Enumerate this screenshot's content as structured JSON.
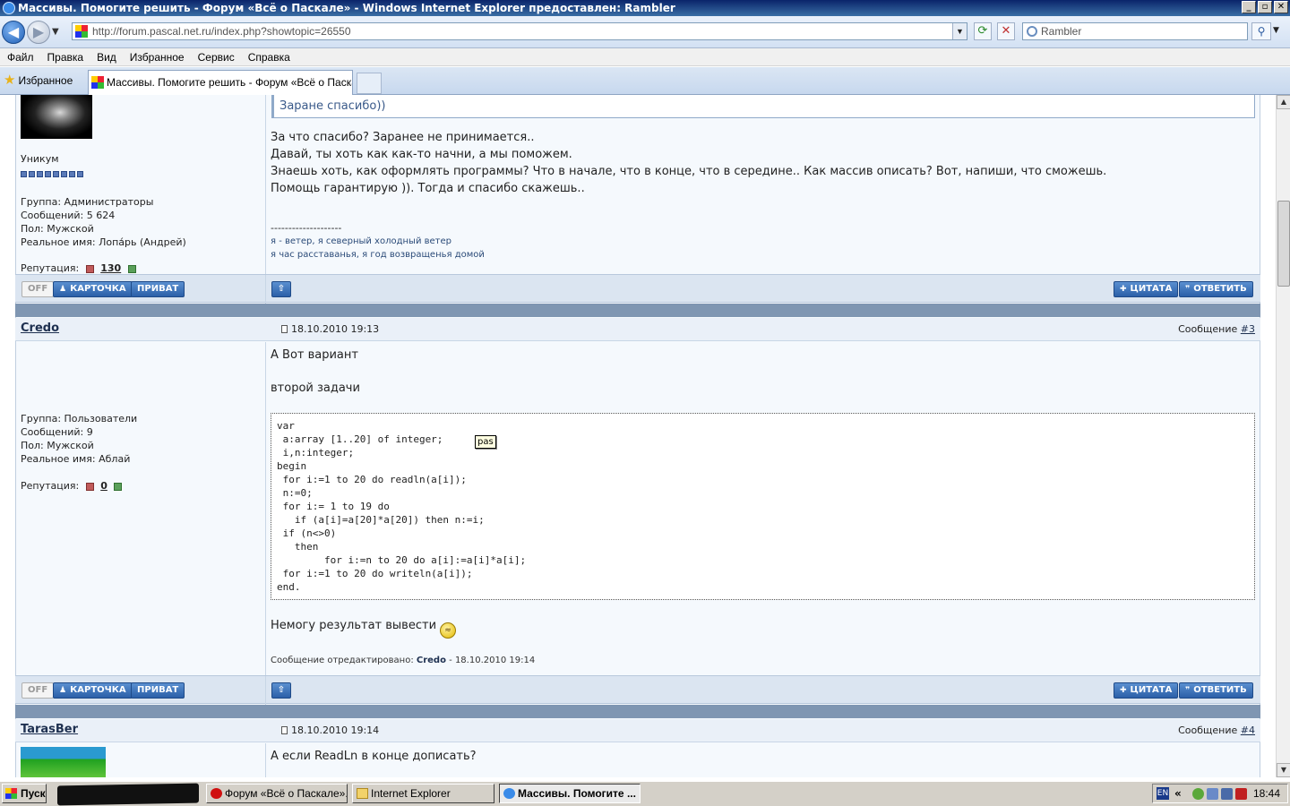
{
  "window": {
    "title": "Массивы. Помогите решить - Форум «Всё о Паскале» - Windows Internet Explorer предоставлен: Rambler",
    "controls": {
      "minimize": "_",
      "maximize": "▫",
      "close": "✕"
    }
  },
  "address": {
    "url": "http://forum.pascal.net.ru/index.php?showtopic=26550",
    "search_placeholder": "Rambler"
  },
  "menu": [
    "Файл",
    "Правка",
    "Вид",
    "Избранное",
    "Сервис",
    "Справка"
  ],
  "tabs": {
    "favorites_label": "Избранное",
    "active_tab": "Массивы. Помогите решить - Форум «Всё о Паскале»"
  },
  "post2": {
    "author": {
      "rank": "Уникум",
      "group": "Группа: Администраторы",
      "messages": "Сообщений: 5 624",
      "gender": "Пол: Мужской",
      "real_name": "Реальное имя: Лопа́рь (Андрей)",
      "reputation_label": "Репутация:",
      "reputation_value": "130"
    },
    "quote": "Заране спасибо))",
    "body": [
      "За что спасибо? Заранее не принимается..",
      "Давай, ты хоть как как-то начни, а мы поможем.",
      "Знаешь хоть, как оформлять программы? Что в начале, что в конце, что в середине.. Как массив описать? Вот, напиши, что сможешь.",
      "Помощь гарантирую )). Тогда и спасибо скажешь.."
    ],
    "signature_sep": "--------------------",
    "signature": [
      "я - ветер, я северный холодный ветер",
      "я час расставанья, я год возвращенья домой"
    ]
  },
  "actions": {
    "off": "OFF",
    "card": "КАРТОЧКА",
    "private": "ПРИВАТ",
    "quote": "ЦИТАТА",
    "reply": "ОТВЕТИТЬ",
    "up": "⇧"
  },
  "post3": {
    "author": "Credo",
    "date": "18.10.2010 19:13",
    "num_label": "Сообщение",
    "num": "#3",
    "author_info": {
      "group": "Группа: Пользователи",
      "messages": "Сообщений: 9",
      "gender": "Пол: Мужской",
      "real_name": "Реальное имя: Аблай",
      "reputation_label": "Репутация:",
      "reputation_value": "0"
    },
    "text1": "А Вот вариант",
    "text2": "второй задачи",
    "code_lang": "pas",
    "code": "var\n a:array [1..20] of integer;\n i,n:integer;\nbegin\n for i:=1 to 20 do readln(a[i]);\n n:=0;\n for i:= 1 to 19 do\n   if (a[i]=a[20]*a[20]) then n:=i;\n if (n<>0)\n   then\n        for i:=n to 20 do a[i]:=a[i]*a[i];\n for i:=1 to 20 do writeln(a[i]);\nend.",
    "after_code": "Немогу результат вывести",
    "edited_prefix": "Сообщение отредактировано:",
    "edited_by": "Credo",
    "edited_date": "- 18.10.2010 19:14"
  },
  "post4": {
    "author": "TarasBer",
    "date": "18.10.2010 19:14",
    "num_label": "Сообщение",
    "num": "#4",
    "text": "А если ReadLn в конце дописать?"
  },
  "taskbar": {
    "start": "Пуск",
    "tasks": [
      {
        "label": "Форум «Всё о Паскале»...",
        "icon": "opera-icon"
      },
      {
        "label": "Internet Explorer",
        "icon": "folder-icon"
      },
      {
        "label": "Массивы. Помогите ...",
        "icon": "ie-icon"
      }
    ],
    "lang": "EN",
    "clock": "18:44"
  }
}
